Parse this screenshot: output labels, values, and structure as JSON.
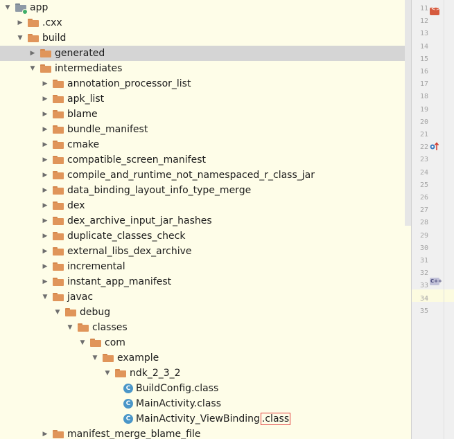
{
  "tree": {
    "rows": [
      {
        "label": "app",
        "depth": 0,
        "expanded": true,
        "icon": "module-folder-icon"
      },
      {
        "label": ".cxx",
        "depth": 1,
        "expanded": false,
        "icon": "folder-icon"
      },
      {
        "label": "build",
        "depth": 1,
        "expanded": true,
        "icon": "folder-icon"
      },
      {
        "label": "generated",
        "depth": 2,
        "expanded": false,
        "icon": "folder-icon",
        "selected": true
      },
      {
        "label": "intermediates",
        "depth": 2,
        "expanded": true,
        "icon": "folder-icon"
      },
      {
        "label": "annotation_processor_list",
        "depth": 3,
        "expanded": false,
        "icon": "folder-icon"
      },
      {
        "label": "apk_list",
        "depth": 3,
        "expanded": false,
        "icon": "folder-icon"
      },
      {
        "label": "blame",
        "depth": 3,
        "expanded": false,
        "icon": "folder-icon"
      },
      {
        "label": "bundle_manifest",
        "depth": 3,
        "expanded": false,
        "icon": "folder-icon"
      },
      {
        "label": "cmake",
        "depth": 3,
        "expanded": false,
        "icon": "folder-icon"
      },
      {
        "label": "compatible_screen_manifest",
        "depth": 3,
        "expanded": false,
        "icon": "folder-icon"
      },
      {
        "label": "compile_and_runtime_not_namespaced_r_class_jar",
        "depth": 3,
        "expanded": false,
        "icon": "folder-icon"
      },
      {
        "label": "data_binding_layout_info_type_merge",
        "depth": 3,
        "expanded": false,
        "icon": "folder-icon"
      },
      {
        "label": "dex",
        "depth": 3,
        "expanded": false,
        "icon": "folder-icon"
      },
      {
        "label": "dex_archive_input_jar_hashes",
        "depth": 3,
        "expanded": false,
        "icon": "folder-icon"
      },
      {
        "label": "duplicate_classes_check",
        "depth": 3,
        "expanded": false,
        "icon": "folder-icon"
      },
      {
        "label": "external_libs_dex_archive",
        "depth": 3,
        "expanded": false,
        "icon": "folder-icon"
      },
      {
        "label": "incremental",
        "depth": 3,
        "expanded": false,
        "icon": "folder-icon"
      },
      {
        "label": "instant_app_manifest",
        "depth": 3,
        "expanded": false,
        "icon": "folder-icon"
      },
      {
        "label": "javac",
        "depth": 3,
        "expanded": true,
        "icon": "folder-icon"
      },
      {
        "label": "debug",
        "depth": 4,
        "expanded": true,
        "icon": "folder-icon"
      },
      {
        "label": "classes",
        "depth": 5,
        "expanded": true,
        "icon": "folder-icon"
      },
      {
        "label": "com",
        "depth": 6,
        "expanded": true,
        "icon": "folder-icon"
      },
      {
        "label": "example",
        "depth": 7,
        "expanded": true,
        "icon": "folder-icon"
      },
      {
        "label": "ndk_2_3_2",
        "depth": 8,
        "expanded": true,
        "icon": "folder-icon"
      },
      {
        "label": "BuildConfig.class",
        "depth": 9,
        "leaf": true,
        "icon": "class-icon"
      },
      {
        "label": "MainActivity.class",
        "depth": 9,
        "leaf": true,
        "icon": "class-icon"
      },
      {
        "label": "MainActivity_ViewBinding",
        "suffix": ".class",
        "depth": 9,
        "leaf": true,
        "icon": "class-icon",
        "highlight_suffix": true
      },
      {
        "label": "manifest_merge_blame_file",
        "depth": 3,
        "expanded": false,
        "icon": "folder-icon"
      }
    ]
  },
  "gutter": {
    "line_numbers": [
      "11",
      "12",
      "13",
      "14",
      "15",
      "16",
      "17",
      "18",
      "19",
      "20",
      "21",
      "22",
      "23",
      "24",
      "25",
      "26",
      "27",
      "28",
      "29",
      "30",
      "31",
      "32",
      "33",
      "34",
      "35"
    ],
    "icons": [
      "xml-tag-icon",
      "override-arrow-icon",
      "cpp-file-icon"
    ]
  },
  "colors": {
    "panel_bg": "#fefde8",
    "selected_row": "#d5d5d5",
    "folder": "#e0955a",
    "class_icon": "#4a96c8",
    "highlight_border": "#e23b3b"
  }
}
